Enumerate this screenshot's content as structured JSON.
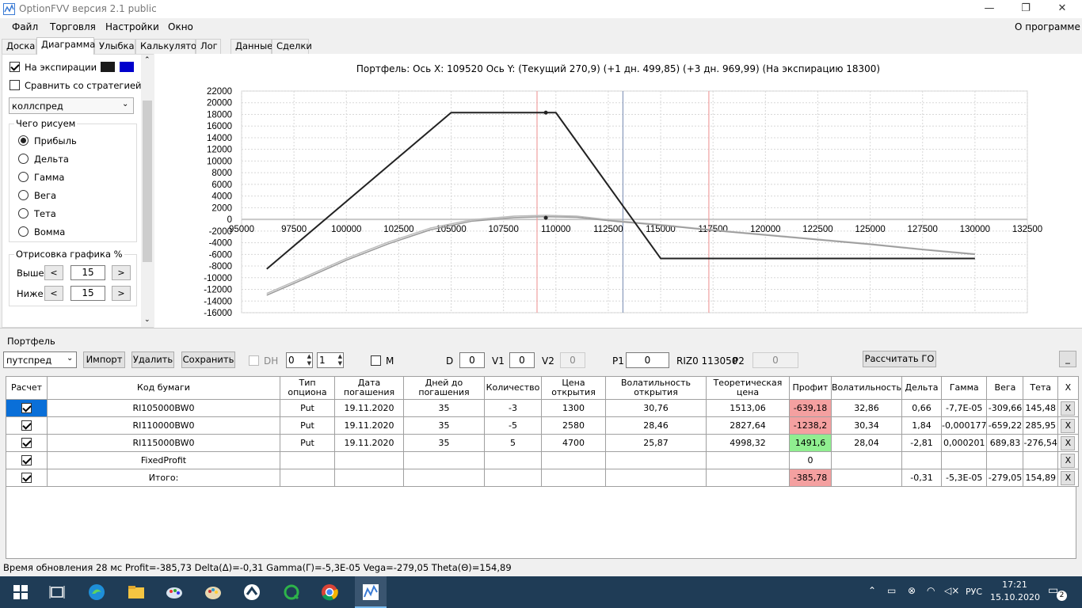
{
  "window": {
    "title": "OptionFVV версия 2.1 public"
  },
  "menu": {
    "items": [
      "Файл",
      "Торговля",
      "Настройки",
      "Окно"
    ],
    "about": "О программе"
  },
  "tabs": [
    "Доска",
    "Диаграмма",
    "Улыбка",
    "Калькулятор",
    "Лог",
    "Данные",
    "Сделки"
  ],
  "active_tab": "Диаграмма",
  "left": {
    "on_expiry_label": "На экспирации",
    "on_expiry_checked": true,
    "compare_label": "Сравнить со стратегией",
    "compare_checked": false,
    "strategy_select": "коллспред",
    "draw_group": "Чего рисуем",
    "draw_options": [
      "Прибыль",
      "Дельта",
      "Гамма",
      "Вега",
      "Тета",
      "Вомма"
    ],
    "draw_selected": "Прибыль",
    "render_group": "Отрисовка графика %",
    "above_label": "Выше",
    "above_value": "15",
    "below_label": "Ниже",
    "below_value": "15",
    "btn_minus": "<",
    "btn_plus": ">",
    "swatch_colors": [
      "#1a1a1a",
      "#0000cc"
    ]
  },
  "chart_header": "Портфель: Ось X:  109520 Ось Y:  (Текущий 270,9)  (+1 дн. 499,85)  (+3 дн. 969,99)  (На экспирацию 18300)",
  "chart_data": {
    "type": "line",
    "xlim": [
      95000,
      132500
    ],
    "ylim": [
      -16000,
      22000
    ],
    "xticks": [
      95000,
      97500,
      100000,
      102500,
      105000,
      107500,
      110000,
      112500,
      115000,
      117500,
      120000,
      122500,
      125000,
      127500,
      130000,
      132500
    ],
    "yticks": [
      22000,
      20000,
      18000,
      16000,
      14000,
      12000,
      10000,
      8000,
      6000,
      4000,
      2000,
      0,
      -2000,
      -4000,
      -6000,
      -8000,
      -10000,
      -12000,
      -14000,
      -16000
    ],
    "vlines": [
      {
        "x": 109100,
        "color": "#f0a0a0"
      },
      {
        "x": 113200,
        "color": "#8899bb"
      },
      {
        "x": 117300,
        "color": "#f0a0a0"
      }
    ],
    "series": [
      {
        "color": "#222222",
        "width": 2,
        "x": [
          96200,
          105000,
          110000,
          115000,
          130000
        ],
        "y": [
          -8500,
          18300,
          18300,
          -6700,
          -6700
        ]
      },
      {
        "color": "#999999",
        "width": 1.5,
        "x": [
          96200,
          98000,
          100000,
          102000,
          104000,
          106000,
          108000,
          109500,
          111000,
          113000,
          115000,
          117500,
          120000,
          122500,
          125000,
          127500,
          130000
        ],
        "y": [
          -13000,
          -10200,
          -7000,
          -4200,
          -1800,
          -300,
          300,
          450,
          350,
          -400,
          -1000,
          -1900,
          -2700,
          -3500,
          -4300,
          -5200,
          -6000
        ]
      },
      {
        "color": "#bbbbbb",
        "width": 1.5,
        "x": [
          96200,
          98000,
          100000,
          102000,
          104000,
          106000,
          108000,
          109500,
          111000,
          113000,
          115000,
          117500,
          120000,
          122500,
          125000,
          127500,
          130000
        ],
        "y": [
          -12700,
          -9900,
          -6700,
          -3900,
          -1500,
          -50,
          550,
          700,
          550,
          -250,
          -900,
          -1800,
          -2600,
          -3400,
          -4200,
          -5100,
          -5900
        ]
      }
    ],
    "markers": [
      {
        "x": 109520,
        "y": 18300
      },
      {
        "x": 109520,
        "y": 270.9
      }
    ]
  },
  "portfolio": {
    "group_label": "Портфель",
    "select_value": "путспред",
    "btn_import": "Импорт",
    "btn_delete": "Удалить",
    "btn_save": "Сохранить",
    "dh_label": "DH",
    "spin1": "0",
    "spin2": "1",
    "m_label": "M",
    "d_label": "D",
    "d_value": "0",
    "v1_label": "V1",
    "v1_value": "0",
    "v2_label": "V2",
    "v2_value": "0",
    "p1_label": "P1",
    "p1_value": "0",
    "riz_label": "RIZ0 113050",
    "p2_label": "P2",
    "p2_value": "0",
    "btn_go": "Рассчитать ГО",
    "btn_min": "_"
  },
  "grid": {
    "headers": [
      "Расчет",
      "Код бумаги",
      "Тип опциона",
      "Дата погашения",
      "Дней до погашения",
      "Количество",
      "Цена открытия",
      "Волатильность открытия",
      "Теоретическая цена",
      "Профит",
      "Волатильность",
      "Дельта",
      "Гамма",
      "Вега",
      "Тета",
      "X"
    ],
    "rows": [
      [
        "RI105000BW0",
        "Put",
        "19.11.2020",
        "35",
        "-3",
        "1300",
        "30,76",
        "1513,06",
        "-639,18",
        "32,86",
        "0,66",
        "-7,7E-05",
        "-309,66",
        "145,48"
      ],
      [
        "RI110000BW0",
        "Put",
        "19.11.2020",
        "35",
        "-5",
        "2580",
        "28,46",
        "2827,64",
        "-1238,2",
        "30,34",
        "1,84",
        "-0,000177",
        "-659,22",
        "285,95"
      ],
      [
        "RI115000BW0",
        "Put",
        "19.11.2020",
        "35",
        "5",
        "4700",
        "25,87",
        "4998,32",
        "1491,6",
        "28,04",
        "-2,81",
        "0,000201",
        "689,83",
        "-276,54"
      ],
      [
        "FixedProfit",
        "",
        "",
        "",
        "",
        "",
        "",
        "",
        "0",
        "",
        "",
        "",
        "",
        ""
      ],
      [
        "Итого:",
        "",
        "",
        "",
        "",
        "",
        "",
        "",
        "-385,78",
        "",
        "-0,31",
        "-5,3E-05",
        "-279,05",
        "154,89"
      ]
    ],
    "x_label": "X"
  },
  "status": "Время обновления 28 мс  Profit=-385,73 Delta(Δ)=-0,31 Gamma(Γ)=-5,3E-05 Vega=-279,05 Theta(Θ)=154,89",
  "taskbar": {
    "lang": "РУС",
    "time": "17:21",
    "date": "15.10.2020",
    "notif": "2"
  }
}
